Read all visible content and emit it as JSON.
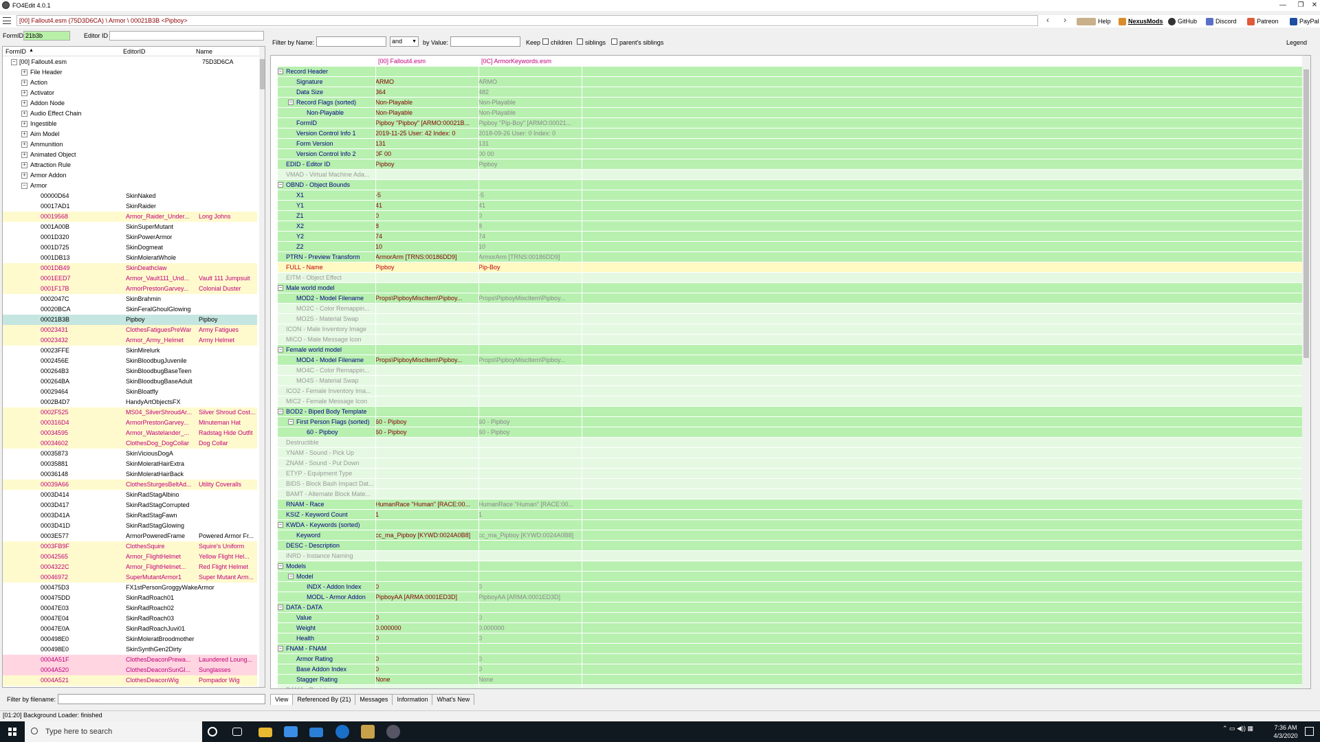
{
  "window": {
    "title": "FO4Edit 4.0.1"
  },
  "path": "[00] Fallout4.esm (75D3D6CA) \\ Armor \\ 00021B3B <Pipboy>",
  "toolbar": {
    "help": "Help",
    "nexus": "NexusMods",
    "github": "GitHub",
    "discord": "Discord",
    "patreon": "Patreon",
    "paypal": "PayPal",
    "legend": "Legend"
  },
  "search": {
    "formid_label": "FormID",
    "formid_value": "21b3b",
    "editorid_label": "Editor ID"
  },
  "filter": {
    "by_name": "Filter by Name:",
    "and": "and",
    "by_value": "by Value:",
    "keep": "Keep",
    "children": "children",
    "siblings": "siblings",
    "parents_siblings": "parent's siblings"
  },
  "left_headers": {
    "formid": "FormID",
    "editorid": "EditorID",
    "name": "Name"
  },
  "tree": [
    {
      "t": "root",
      "c1": "[00] Fallout4.esm",
      "c3": "75D3D6CA"
    },
    {
      "t": "g",
      "c1": "File Header"
    },
    {
      "t": "g",
      "c1": "Action"
    },
    {
      "t": "g",
      "c1": "Activator"
    },
    {
      "t": "g",
      "c1": "Addon Node"
    },
    {
      "t": "g",
      "c1": "Audio Effect Chain"
    },
    {
      "t": "g",
      "c1": "Ingestible"
    },
    {
      "t": "g",
      "c1": "Aim Model"
    },
    {
      "t": "g",
      "c1": "Ammunition"
    },
    {
      "t": "g",
      "c1": "Animated Object"
    },
    {
      "t": "g",
      "c1": "Attraction Rule"
    },
    {
      "t": "g",
      "c1": "Armor Addon"
    },
    {
      "t": "g",
      "c1": "Armor"
    },
    {
      "t": "r",
      "c1": "00000D64",
      "c2": "SkinNaked"
    },
    {
      "t": "r",
      "c1": "00017AD1",
      "c2": "SkinRaider"
    },
    {
      "t": "h",
      "c1": "00019568",
      "c2": "Armor_Raider_Under...",
      "c3": "Long Johns"
    },
    {
      "t": "r",
      "c1": "0001A00B",
      "c2": "SkinSuperMutant"
    },
    {
      "t": "r",
      "c1": "0001D320",
      "c2": "SkinPowerArmor"
    },
    {
      "t": "r",
      "c1": "0001D725",
      "c2": "SkinDogmeat"
    },
    {
      "t": "r",
      "c1": "0001DB13",
      "c2": "SkinMoleratWhole"
    },
    {
      "t": "h",
      "c1": "0001DB49",
      "c2": "SkinDeathclaw"
    },
    {
      "t": "h",
      "c1": "0001EED7",
      "c2": "Armor_Vault111_Und...",
      "c3": "Vault 111 Jumpsuit"
    },
    {
      "t": "h",
      "c1": "0001F17B",
      "c2": "ArmorPrestonGarvey...",
      "c3": "Colonial Duster"
    },
    {
      "t": "r",
      "c1": "0002047C",
      "c2": "SkinBrahmin"
    },
    {
      "t": "r",
      "c1": "00020BCA",
      "c2": "SkinFeralGhoulGlowing"
    },
    {
      "t": "s",
      "c1": "00021B3B",
      "c2": "Pipboy",
      "c3": "Pipboy"
    },
    {
      "t": "h",
      "c1": "00023431",
      "c2": "ClothesFatiguesPreWar",
      "c3": "Army Fatigues"
    },
    {
      "t": "h",
      "c1": "00023432",
      "c2": "Armor_Army_Helmet",
      "c3": "Army Helmet"
    },
    {
      "t": "r",
      "c1": "00023FFE",
      "c2": "SkinMirelurk"
    },
    {
      "t": "r",
      "c1": "0002456E",
      "c2": "SkinBloodbugJuvenile"
    },
    {
      "t": "r",
      "c1": "000264B3",
      "c2": "SkinBloodbugBaseTeen"
    },
    {
      "t": "r",
      "c1": "000264BA",
      "c2": "SkinBloodbugBaseAdult"
    },
    {
      "t": "r",
      "c1": "00029464",
      "c2": "SkinBloatfly"
    },
    {
      "t": "r",
      "c1": "0002B4D7",
      "c2": "HandyArtObjectsFX"
    },
    {
      "t": "h",
      "c1": "0002F525",
      "c2": "MS04_SilverShroudAr...",
      "c3": "Silver Shroud Cost..."
    },
    {
      "t": "h",
      "c1": "000316D4",
      "c2": "ArmorPrestonGarvey...",
      "c3": "Minuteman Hat"
    },
    {
      "t": "h",
      "c1": "00034595",
      "c2": "Armor_Wastelander_...",
      "c3": "Radstag Hide Outfit"
    },
    {
      "t": "h",
      "c1": "00034602",
      "c2": "ClothesDog_DogCollar",
      "c3": "Dog Collar"
    },
    {
      "t": "r",
      "c1": "00035873",
      "c2": "SkinViciousDogA"
    },
    {
      "t": "r",
      "c1": "00035881",
      "c2": "SkinMoleratHairExtra"
    },
    {
      "t": "r",
      "c1": "00036148",
      "c2": "SkinMoleratHairBack"
    },
    {
      "t": "h",
      "c1": "00039A66",
      "c2": "ClothesSturgesBeltAd...",
      "c3": "Utility Coveralls"
    },
    {
      "t": "r",
      "c1": "0003D414",
      "c2": "SkinRadStagAlbino"
    },
    {
      "t": "r",
      "c1": "0003D417",
      "c2": "SkinRadStagCorrupted"
    },
    {
      "t": "r",
      "c1": "0003D41A",
      "c2": "SkinRadStagFawn"
    },
    {
      "t": "r",
      "c1": "0003D41D",
      "c2": "SkinRadStagGlowing"
    },
    {
      "t": "r",
      "c1": "0003E577",
      "c2": "ArmorPoweredFrame",
      "c3": "Powered Armor Fr..."
    },
    {
      "t": "h",
      "c1": "0003FB9F",
      "c2": "ClothesSquire",
      "c3": "Squire's Uniform"
    },
    {
      "t": "h",
      "c1": "00042565",
      "c2": "Armor_FlightHelmet",
      "c3": "Yellow Flight Hel..."
    },
    {
      "t": "h",
      "c1": "0004322C",
      "c2": "Armor_FlightHelmet...",
      "c3": "Red Flight Helmet"
    },
    {
      "t": "h",
      "c1": "00046972",
      "c2": "SuperMutantArmor1",
      "c3": "Super Mutant Arm..."
    },
    {
      "t": "r",
      "c1": "000475D3",
      "c2": "FX1stPersonGroggyWakeArmor"
    },
    {
      "t": "r",
      "c1": "000475DD",
      "c2": "SkinRadRoach01"
    },
    {
      "t": "r",
      "c1": "00047E03",
      "c2": "SkinRadRoach02"
    },
    {
      "t": "r",
      "c1": "00047E04",
      "c2": "SkinRadRoach03"
    },
    {
      "t": "r",
      "c1": "00047E0A",
      "c2": "SkinRadRoachJuvi01"
    },
    {
      "t": "r",
      "c1": "000498E0",
      "c2": "SkinMoleratBroodmother"
    },
    {
      "t": "r",
      "c1": "000498E0",
      "c2": "SkinSynthGen2Dirty"
    },
    {
      "t": "p",
      "c1": "0004A51F",
      "c2": "ClothesDeaconPrewa...",
      "c3": "Laundered Loung..."
    },
    {
      "t": "p",
      "c1": "0004A520",
      "c2": "ClothesDeaconSunGl...",
      "c3": "Sunglasses"
    },
    {
      "t": "h",
      "c1": "0004A521",
      "c2": "ClothesDeaconWig",
      "c3": "Pompador Wig"
    }
  ],
  "filter_filename": "Filter by filename:",
  "right_headers": {
    "col1": "[00] Fallout4.esm",
    "col2": "[0C] ArmorKeywords.esm"
  },
  "grid": [
    {
      "l": 0,
      "x": "-",
      "lbl": "Record Header",
      "v1": "",
      "v2": ""
    },
    {
      "l": 1,
      "lbl": "Signature",
      "v1": "ARMO",
      "v2": "ARMO"
    },
    {
      "l": 1,
      "lbl": "Data Size",
      "v1": "364",
      "v2": "482"
    },
    {
      "l": 1,
      "x": "-",
      "lbl": "Record Flags (sorted)",
      "v1": "Non-Playable",
      "v2": "Non-Playable"
    },
    {
      "l": 2,
      "lbl": "Non-Playable",
      "v1": "Non-Playable",
      "v2": "Non-Playable"
    },
    {
      "l": 1,
      "lbl": "FormID",
      "v1": "Pipboy \"Pipboy\" [ARMO:00021B...",
      "v2": "Pipboy \"Pip-Boy\" [ARMO:00021..."
    },
    {
      "l": 1,
      "lbl": "Version Control Info 1",
      "v1": "2019-11-25 User: 42 Index: 0",
      "v2": "2018-09-26 User: 0 Index: 0"
    },
    {
      "l": 1,
      "lbl": "Form Version",
      "v1": "131",
      "v2": "131"
    },
    {
      "l": 1,
      "lbl": "Version Control Info 2",
      "v1": "0F 00",
      "v2": "00 00"
    },
    {
      "l": 0,
      "lbl": "EDID - Editor ID",
      "v1": "Pipboy",
      "v2": "Pipboy"
    },
    {
      "l": 0,
      "d": 1,
      "lbl": "VMAD - Virtual Machine Ada...",
      "v1": "",
      "v2": ""
    },
    {
      "l": 0,
      "x": "-",
      "lbl": "OBND - Object Bounds",
      "v1": "",
      "v2": ""
    },
    {
      "l": 1,
      "lbl": "X1",
      "v1": "-5",
      "v2": "-5"
    },
    {
      "l": 1,
      "lbl": "Y1",
      "v1": "41",
      "v2": "41"
    },
    {
      "l": 1,
      "lbl": "Z1",
      "v1": "0",
      "v2": "0"
    },
    {
      "l": 1,
      "lbl": "X2",
      "v1": "8",
      "v2": "8"
    },
    {
      "l": 1,
      "lbl": "Y2",
      "v1": "74",
      "v2": "74"
    },
    {
      "l": 1,
      "lbl": "Z2",
      "v1": "10",
      "v2": "10"
    },
    {
      "l": 0,
      "lbl": "PTRN - Preview Transform",
      "v1": "ArmorArm [TRNS:00186DD9]",
      "v2": "ArmorArm [TRNS:00186DD9]"
    },
    {
      "l": 0,
      "y": 1,
      "lbl": "FULL - Name",
      "v1": "Pipboy",
      "v2": "Pip-Boy"
    },
    {
      "l": 0,
      "d": 1,
      "lbl": "EITM - Object Effect",
      "v1": "",
      "v2": ""
    },
    {
      "l": 0,
      "x": "-",
      "lbl": "Male world model",
      "v1": "",
      "v2": ""
    },
    {
      "l": 1,
      "lbl": "MOD2 - Model Filename",
      "v1": "Props\\PipboyMiscItem\\Pipboy...",
      "v2": "Props\\PipboyMiscItem\\Pipboy..."
    },
    {
      "l": 1,
      "d": 1,
      "lbl": "MO2C - Color Remappin...",
      "v1": "",
      "v2": ""
    },
    {
      "l": 1,
      "d": 1,
      "lbl": "MO2S - Material Swap",
      "v1": "",
      "v2": ""
    },
    {
      "l": 0,
      "d": 1,
      "lbl": "ICON - Male Inventory Image",
      "v1": "",
      "v2": ""
    },
    {
      "l": 0,
      "d": 1,
      "lbl": "MICO - Male Message Icon",
      "v1": "",
      "v2": ""
    },
    {
      "l": 0,
      "x": "-",
      "lbl": "Female world model",
      "v1": "",
      "v2": ""
    },
    {
      "l": 1,
      "lbl": "MOD4 - Model Filename",
      "v1": "Props\\PipboyMiscItem\\Pipboy...",
      "v2": "Props\\PipboyMiscItem\\Pipboy..."
    },
    {
      "l": 1,
      "d": 1,
      "lbl": "MO4C - Color Remappin...",
      "v1": "",
      "v2": ""
    },
    {
      "l": 1,
      "d": 1,
      "lbl": "MO4S - Material Swap",
      "v1": "",
      "v2": ""
    },
    {
      "l": 0,
      "d": 1,
      "lbl": "ICO2 - Female Inventory Ima...",
      "v1": "",
      "v2": ""
    },
    {
      "l": 0,
      "d": 1,
      "lbl": "MIC2 - Female Message Icon",
      "v1": "",
      "v2": ""
    },
    {
      "l": 0,
      "x": "-",
      "lbl": "BOD2 - Biped Body Template",
      "v1": "",
      "v2": ""
    },
    {
      "l": 1,
      "x": "-",
      "lbl": "First Person Flags (sorted)",
      "v1": "60 - Pipboy",
      "v2": "60 - Pipboy"
    },
    {
      "l": 2,
      "lbl": "60 - Pipboy",
      "v1": "60 - Pipboy",
      "v2": "60 - Pipboy"
    },
    {
      "l": 0,
      "d": 1,
      "lbl": "Destructible",
      "v1": "",
      "v2": ""
    },
    {
      "l": 0,
      "d": 1,
      "lbl": "YNAM - Sound - Pick Up",
      "v1": "",
      "v2": ""
    },
    {
      "l": 0,
      "d": 1,
      "lbl": "ZNAM - Sound - Put Down",
      "v1": "",
      "v2": ""
    },
    {
      "l": 0,
      "d": 1,
      "lbl": "ETYP - Equipment Type",
      "v1": "",
      "v2": ""
    },
    {
      "l": 0,
      "d": 1,
      "lbl": "BIDS - Block Bash Impact Dat...",
      "v1": "",
      "v2": ""
    },
    {
      "l": 0,
      "d": 1,
      "lbl": "BAMT - Alternate Block Mate...",
      "v1": "",
      "v2": ""
    },
    {
      "l": 0,
      "lbl": "RNAM - Race",
      "v1": "HumanRace \"Human\" [RACE:00...",
      "v2": "HumanRace \"Human\" [RACE:00..."
    },
    {
      "l": 0,
      "lbl": "KSIZ - Keyword Count",
      "v1": "1",
      "v2": "1"
    },
    {
      "l": 0,
      "x": "-",
      "lbl": "KWDA - Keywords (sorted)",
      "v1": "",
      "v2": ""
    },
    {
      "l": 1,
      "lbl": "Keyword",
      "v1": "cc_ma_Pipboy [KYWD:0024A0B8]",
      "v2": "cc_ma_Pipboy [KYWD:0024A0B8]"
    },
    {
      "l": 0,
      "lbl": "DESC - Description",
      "v1": "",
      "v2": ""
    },
    {
      "l": 0,
      "d": 1,
      "lbl": "INRD - Instance Naming",
      "v1": "",
      "v2": ""
    },
    {
      "l": 0,
      "x": "-",
      "lbl": "Models",
      "v1": "",
      "v2": ""
    },
    {
      "l": 1,
      "x": "-",
      "lbl": "Model",
      "v1": "",
      "v2": ""
    },
    {
      "l": 2,
      "lbl": "INDX - Addon Index",
      "v1": "0",
      "v2": "0"
    },
    {
      "l": 2,
      "lbl": "MODL - Armor Addon",
      "v1": "PipboyAA [ARMA:0001ED3D]",
      "v2": "PipboyAA [ARMA:0001ED3D]"
    },
    {
      "l": 0,
      "x": "-",
      "lbl": "DATA - DATA",
      "v1": "",
      "v2": ""
    },
    {
      "l": 1,
      "lbl": "Value",
      "v1": "0",
      "v2": "0"
    },
    {
      "l": 1,
      "lbl": "Weight",
      "v1": "0.000000",
      "v2": "0.000000"
    },
    {
      "l": 1,
      "lbl": "Health",
      "v1": "0",
      "v2": "0"
    },
    {
      "l": 0,
      "x": "-",
      "lbl": "FNAM - FNAM",
      "v1": "",
      "v2": ""
    },
    {
      "l": 1,
      "lbl": "Armor Rating",
      "v1": "0",
      "v2": "0"
    },
    {
      "l": 1,
      "lbl": "Base Addon Index",
      "v1": "0",
      "v2": "0"
    },
    {
      "l": 1,
      "lbl": "Stagger Rating",
      "v1": "None",
      "v2": "None"
    },
    {
      "l": 0,
      "d": 1,
      "lbl": "DAMA - Resistances",
      "v1": "",
      "v2": ""
    }
  ],
  "tabs": [
    "View",
    "Referenced By (21)",
    "Messages",
    "Information",
    "What's New"
  ],
  "status": "[01:20] Background Loader: finished",
  "taskbar": {
    "search": "Type here to search",
    "time": "7:36 AM",
    "date": "4/3/2020"
  }
}
